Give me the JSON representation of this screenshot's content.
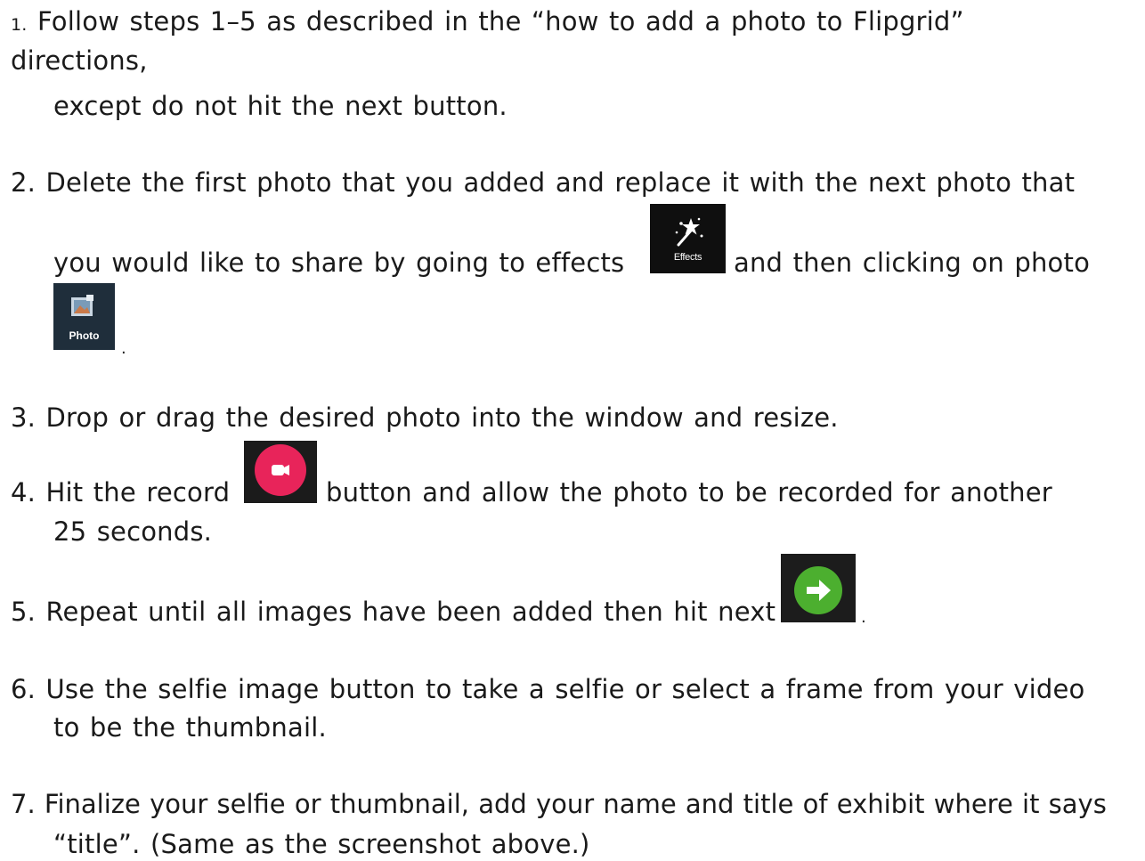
{
  "steps": {
    "s1": {
      "num": "1.",
      "line1": "Follow steps 1–5 as described in the “how to add a photo to Flipgrid”",
      "line2": "directions,",
      "line3": "except do not hit the next button."
    },
    "s2": {
      "line1": "2. Delete the first photo that you added and replace it with the next photo that",
      "line2a": "you would like to share by going to effects",
      "line2b": "and then clicking on photo",
      "effects_label": "Effects",
      "photo_label": "Photo",
      "tail": "."
    },
    "s3": {
      "line1": "3.  Drop or drag the desired photo into the window and resize."
    },
    "s4": {
      "line1a": "4.  Hit the record",
      "line1b": "button and allow the photo to be recorded for another",
      "line2": "25 seconds."
    },
    "s5": {
      "line1": "5. Repeat until all images have been added then hit next",
      "tail": "."
    },
    "s6": {
      "line1": "6. Use the selfie image button to take a selfie or select a frame from your video",
      "line2": "to be the thumbnail."
    },
    "s7": {
      "line1": "7. Finalize your selfie or thumbnail, add your name and title of exhibit where it says",
      "line2": "“title”. (Same as the screenshot above.)"
    }
  },
  "icons": {
    "effects": "magic-wand-icon",
    "photo": "photo-icon",
    "record": "record-video-icon",
    "next": "arrow-right-icon"
  },
  "colors": {
    "text": "#1a1a1a",
    "record_red": "#e8245a",
    "next_green": "#4caf2f"
  }
}
